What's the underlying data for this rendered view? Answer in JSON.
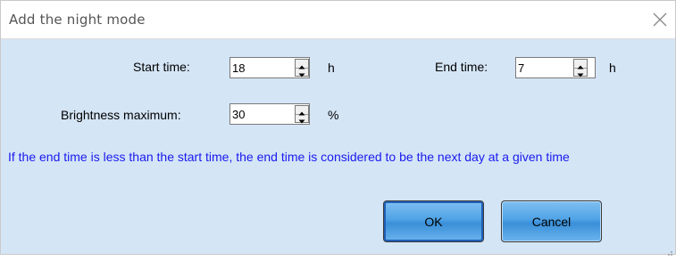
{
  "dialog": {
    "title": "Add the night mode"
  },
  "form": {
    "start_label": "Start time:",
    "start_value": "18",
    "start_unit": "h",
    "end_label": "End time:",
    "end_value": "7",
    "end_unit": "h",
    "brightness_label": "Brightness maximum:",
    "brightness_value": "30",
    "brightness_unit": "%"
  },
  "note": "If the end time is less than the start time, the end time is considered to be the next day at a given time",
  "buttons": {
    "ok_label": "OK",
    "cancel_label": "Cancel"
  },
  "icons": {
    "close": "close-icon",
    "spin_up": "spin-up-icon",
    "spin_down": "spin-down-icon",
    "resize": "resize-grip-icon"
  },
  "colors": {
    "background": "#d4e5f6",
    "note_text": "#1a1aee",
    "button": "#4fa3e6"
  }
}
